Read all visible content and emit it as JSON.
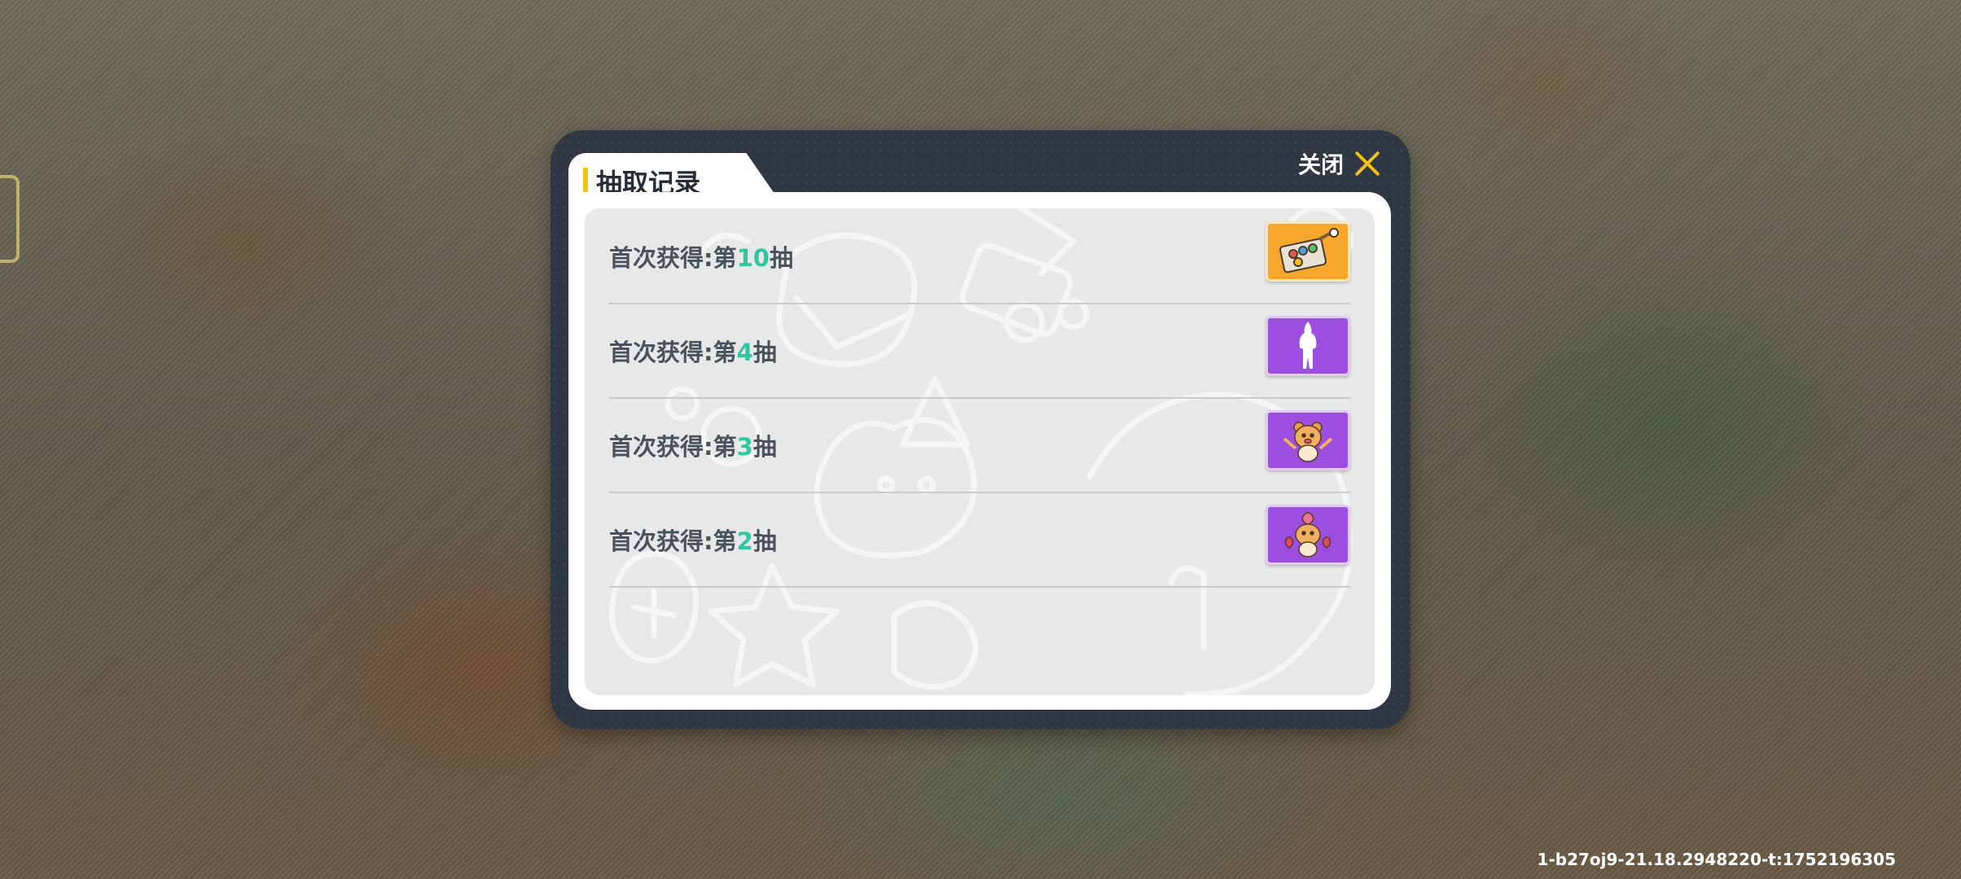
{
  "dialog": {
    "title": "抽取记录",
    "close_label": "关闭"
  },
  "records": [
    {
      "prefix": "首次获得:第",
      "number": "10",
      "suffix": "抽",
      "icon": "paintbox-icon",
      "color": "#f7a72b"
    },
    {
      "prefix": "首次获得:第",
      "number": "4",
      "suffix": "抽",
      "icon": "figure-silhouette-icon",
      "color": "#9b4ee0"
    },
    {
      "prefix": "首次获得:第",
      "number": "3",
      "suffix": "抽",
      "icon": "bear-waving-icon",
      "color": "#9b4ee0"
    },
    {
      "prefix": "首次获得:第",
      "number": "2",
      "suffix": "抽",
      "icon": "bear-hearts-icon",
      "color": "#9b4ee0"
    }
  ],
  "build_id": "1-b27oj9-21.18.2948220-t:1752196305",
  "colors": {
    "accent": "#f2c21a",
    "number_highlight": "#2fc6a0",
    "modal_frame": "#2e3742"
  }
}
